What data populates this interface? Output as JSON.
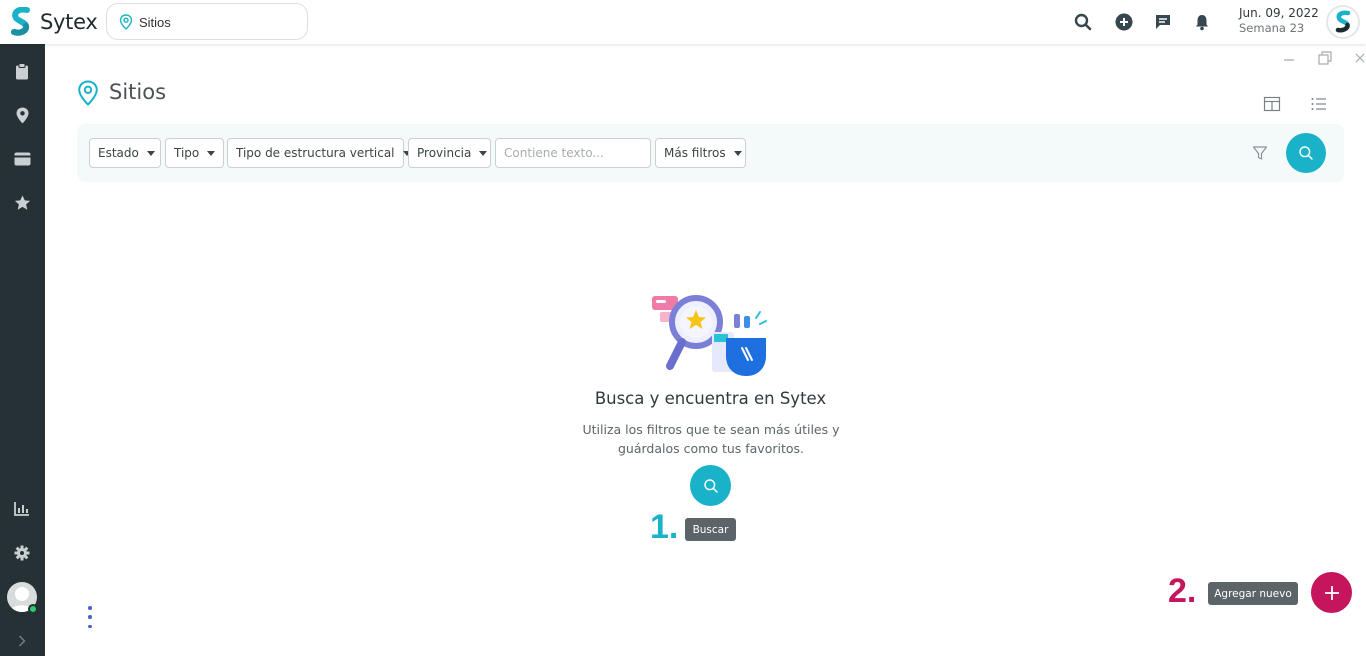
{
  "brand": {
    "name": "Sytex",
    "accent_color": "#1ab2c8",
    "secondary_color": "#c4155d"
  },
  "topbar": {
    "search": {
      "value": "Sitios",
      "icon": "map-pin-icon"
    },
    "icons": [
      "search-icon",
      "add-circle-icon",
      "chat-icon",
      "bell-icon"
    ],
    "date": "Jun. 09, 2022",
    "week": "Semana 23"
  },
  "sidebar": {
    "items": [
      {
        "icon": "clipboard-icon"
      },
      {
        "icon": "location-icon"
      },
      {
        "icon": "wallet-icon"
      },
      {
        "icon": "star-icon"
      }
    ],
    "bottom_items": [
      {
        "icon": "chart-icon"
      },
      {
        "icon": "gear-icon"
      },
      {
        "icon": "user-avatar-icon"
      },
      {
        "icon": "chevron-right-icon"
      }
    ]
  },
  "page": {
    "title": "Sitios",
    "icon": "map-pin-icon",
    "view_icons": [
      "table-view-icon",
      "list-view-icon"
    ]
  },
  "filters": {
    "dropdowns": [
      "Estado",
      "Tipo",
      "Tipo de estructura vertical",
      "Provincia"
    ],
    "text_placeholder": "Contiene texto...",
    "more": "Más filtros"
  },
  "empty_state": {
    "title": "Busca y encuentra en Sytex",
    "description": "Utiliza los filtros que te sean más útiles y guárdalos como tus favoritos.",
    "search_tooltip": "Buscar",
    "step_label": "1."
  },
  "fab": {
    "tooltip": "Agregar nuevo",
    "step_label": "2."
  }
}
